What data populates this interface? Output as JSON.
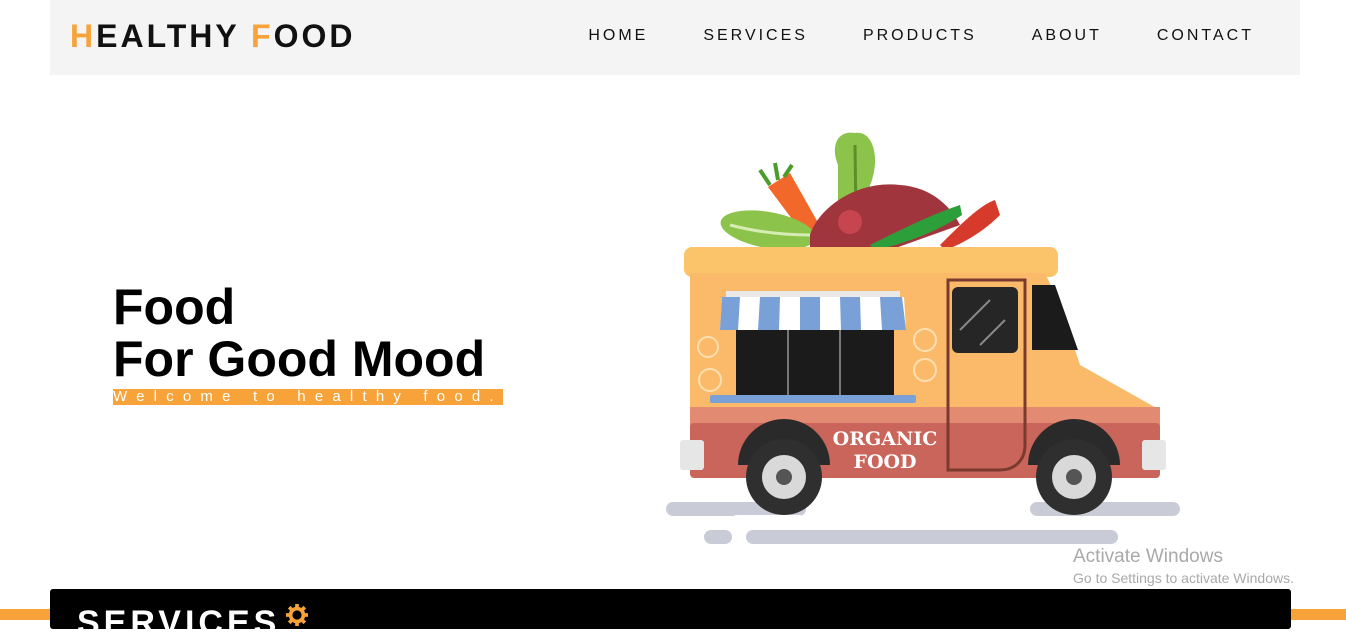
{
  "brand": {
    "first_accent": "H",
    "first_rest": "EALTHY ",
    "second_accent": "F",
    "second_rest": "OOD"
  },
  "nav": {
    "items": [
      "HOME",
      "SERVICES",
      "PRODUCTS",
      "ABOUT",
      "CONTACT"
    ]
  },
  "hero": {
    "line1": "Food",
    "line2": "For Good Mood",
    "subtitle": "Welcome to healthy food."
  },
  "truck": {
    "sign_line1": "ORGANIC",
    "sign_line2": "FOOD"
  },
  "services": {
    "title": "SERVICES"
  },
  "watermark": {
    "line1": "Activate Windows",
    "line2": "Go to Settings to activate Windows."
  },
  "colors": {
    "accent": "#f7a33a",
    "navbar_bg": "#f4f4f4",
    "services_bg": "#000000"
  },
  "icons": {
    "services": "gear-icon"
  }
}
